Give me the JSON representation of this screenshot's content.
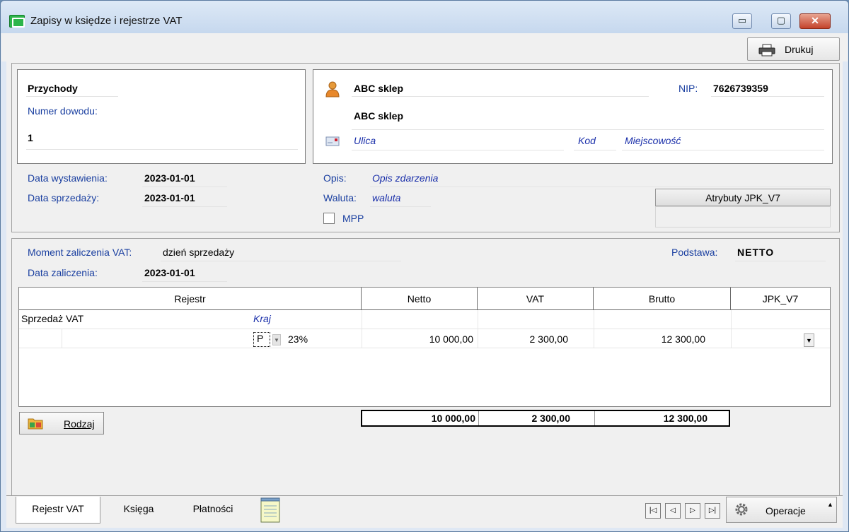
{
  "window": {
    "title": "Zapisy w księdze i rejestrze VAT",
    "min_glyph": "▭",
    "max_glyph": "▢",
    "close_glyph": "✕"
  },
  "toolbar": {
    "print_label": "Drukuj",
    "print_icon": "printer-icon"
  },
  "document": {
    "type": "Przychody",
    "number_label": "Numer dowodu:",
    "number": "1",
    "issue_date_label": "Data wystawienia:",
    "issue_date": "2023-01-01",
    "sale_date_label": "Data sprzedaży:",
    "sale_date": "2023-01-01"
  },
  "contractor": {
    "icon": "person-icon",
    "name": "ABC sklep",
    "full_name": "ABC sklep",
    "nip_label": "NIP:",
    "nip": "7626739359",
    "address_icon": "envelope-icon",
    "street_placeholder": "Ulica",
    "zip_placeholder": "Kod",
    "city_placeholder": "Miejscowość"
  },
  "details": {
    "desc_label": "Opis:",
    "desc_placeholder": "Opis zdarzenia",
    "currency_label": "Waluta:",
    "currency_placeholder": "waluta",
    "mpp_label": "MPP",
    "mpp_checked": false,
    "jpk_button": "Atrybuty JPK_V7"
  },
  "vat": {
    "moment_label": "Moment zaliczenia VAT:",
    "moment_value": "dzień sprzedaży",
    "date_label": "Data zaliczenia:",
    "date_value": "2023-01-01",
    "basis_label": "Podstawa:",
    "basis_value": "NETTO"
  },
  "grid": {
    "headers": [
      "Rejestr",
      "Netto",
      "VAT",
      "Brutto",
      "JPK_V7"
    ],
    "group_name": "Sprzedaż VAT",
    "group_country": "Kraj",
    "row": {
      "type": "P",
      "rate": "23%",
      "netto": "10 000,00",
      "vat": "2 300,00",
      "brutto": "12 300,00"
    },
    "totals": {
      "netto": "10 000,00",
      "vat": "2 300,00",
      "brutto": "12 300,00"
    }
  },
  "rodzaj_button": "Rodzaj",
  "tabs": [
    "Rejestr VAT",
    "Księga",
    "Płatności"
  ],
  "nav": [
    "|◁",
    "◁",
    "▷",
    "▷|"
  ],
  "operations": {
    "label": "Operacje",
    "icon": "gear-icon"
  }
}
